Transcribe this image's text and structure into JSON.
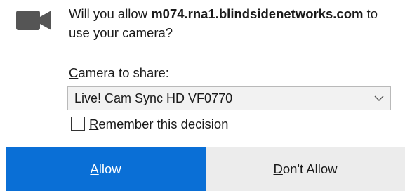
{
  "dialog": {
    "icon": "camera-icon",
    "prompt": {
      "before": "Will you allow ",
      "host": "m074.rna1.blindsidenetworks.com",
      "after": " to use your camera?"
    },
    "camera_label": {
      "access_key": "C",
      "rest": "amera to share:"
    },
    "camera_select": {
      "selected": "Live! Cam Sync HD VF0770"
    },
    "remember": {
      "checked": false,
      "access_key": "R",
      "rest": "emember this decision"
    },
    "buttons": {
      "allow": {
        "access_key": "A",
        "rest": "llow"
      },
      "deny": {
        "pre": "",
        "access_key": "D",
        "rest": "on't Allow"
      }
    }
  },
  "colors": {
    "allow_bg": "#0a6fd6",
    "deny_bg": "#ececec",
    "icon": "#555555"
  }
}
